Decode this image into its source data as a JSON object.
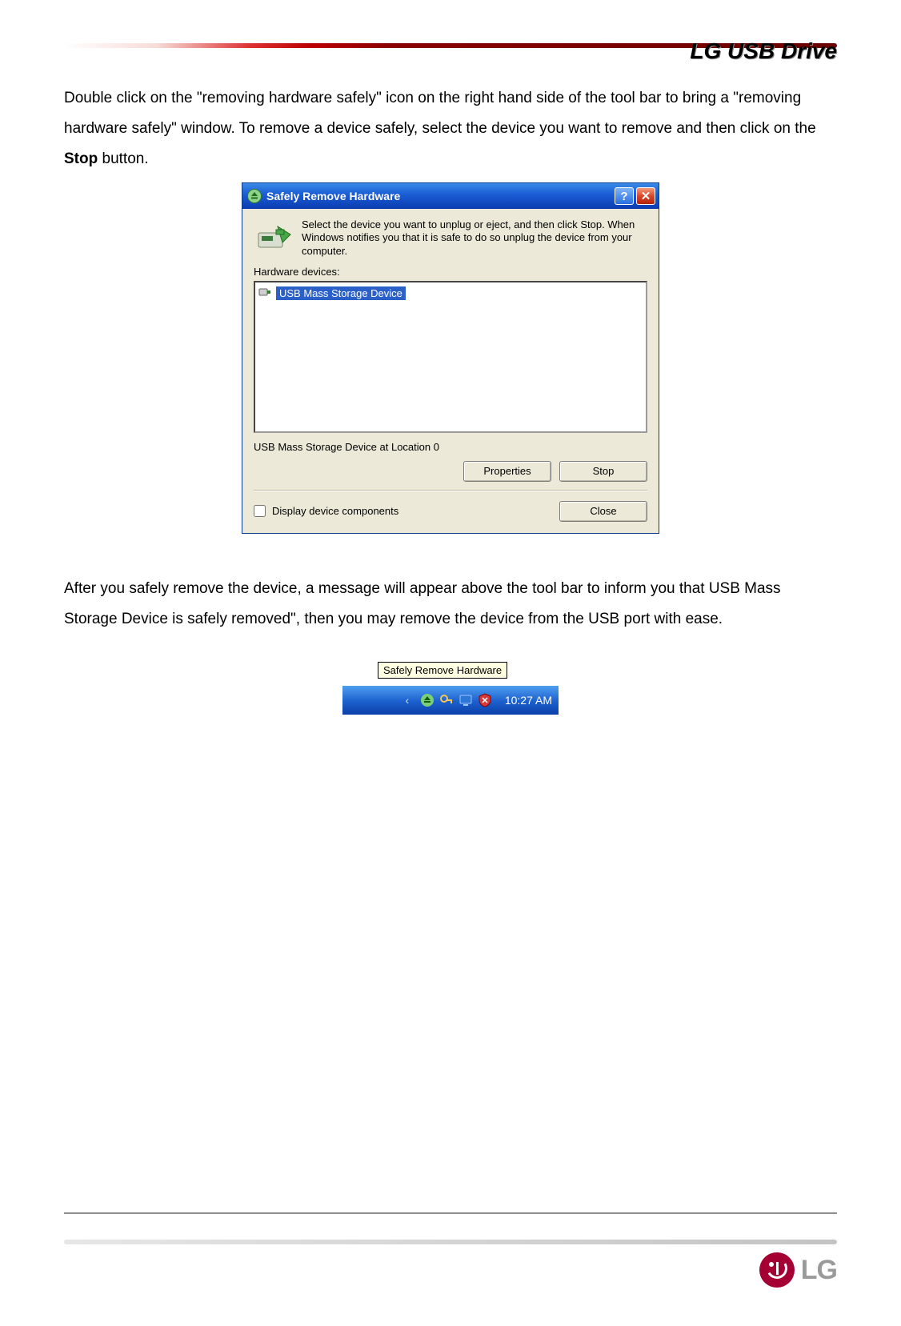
{
  "header": {
    "title": "LG USB Drive"
  },
  "para1": {
    "t1": "Double click on the \"removing hardware safely\" icon on the right hand side of the tool bar to bring a \"removing hardware safely\" window. To remove a device safely, select the device you want to remove and then click on the ",
    "bold": "Stop",
    "t2": " button."
  },
  "dialog": {
    "title": "Safely Remove Hardware",
    "intro": "Select the device you want to unplug or eject, and then click Stop. When Windows notifies you that it is safe to do so unplug the device from your computer.",
    "devices_label": "Hardware devices:",
    "selected_item": "USB Mass Storage Device",
    "status_line": "USB Mass Storage Device at Location 0",
    "properties_btn": "Properties",
    "stop_btn": "Stop",
    "display_components": "Display device components",
    "close_btn": "Close"
  },
  "para2": "After you safely remove the device, a message will appear above the tool bar to inform you that USB Mass Storage Device is safely removed\", then you may remove the device from the USB port with ease.",
  "tray": {
    "tooltip": "Safely Remove Hardware",
    "clock": "10:27 AM",
    "icons": [
      "eject",
      "keys",
      "display",
      "shield"
    ]
  },
  "footer": {
    "logo_text": "LG"
  }
}
